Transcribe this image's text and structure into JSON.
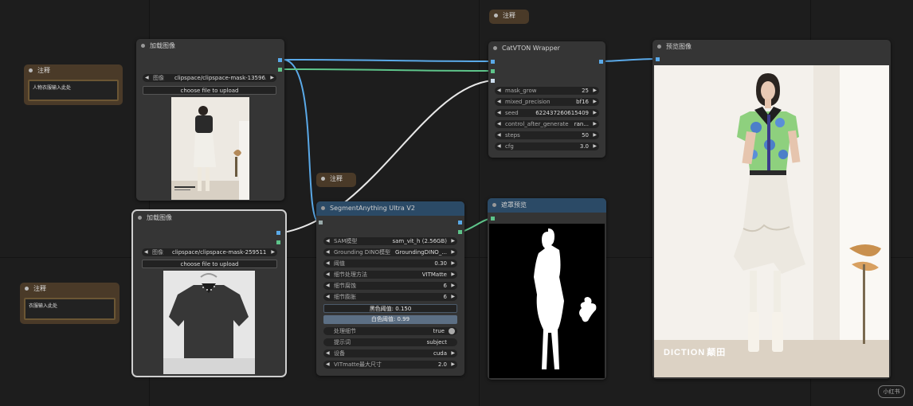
{
  "notes": {
    "top": {
      "title": "注释"
    },
    "left1": {
      "title": "注释",
      "text": "人物衣服输入此处"
    },
    "middle": {
      "title": "注释"
    },
    "left2": {
      "title": "注释",
      "text": "衣服输入此处"
    }
  },
  "load_image_1": {
    "title": "加载图像",
    "image_label": "图像",
    "image_value": "clipspace/clipspace-mask-13596...",
    "upload_label": "choose file to upload"
  },
  "load_image_2": {
    "title": "加载图像",
    "image_label": "图像",
    "image_value": "clipspace/clipspace-mask-259511...",
    "upload_label": "choose file to upload"
  },
  "segment": {
    "title": "SegmentAnything Ultra V2",
    "widgets": [
      {
        "label": "SAM模型",
        "value": "sam_vit_h (2.56GB)"
      },
      {
        "label": "Grounding DINO模型",
        "value": "GroundingDINO_..."
      },
      {
        "label": "阈值",
        "value": "0.30"
      },
      {
        "label": "细节处理方法",
        "value": "VITMatte"
      },
      {
        "label": "细节腐蚀",
        "value": "6"
      },
      {
        "label": "细节膨胀",
        "value": "6"
      }
    ],
    "black_point": "黑色阈值: 0.150",
    "white_point": "白色阈值: 0.99",
    "process_detail_label": "处理细节",
    "process_detail_value": "true",
    "prompt_label": "提示词",
    "prompt_value": "subject",
    "device_label": "设备",
    "device_value": "cuda",
    "max_size_label": "VITmatte最大尺寸",
    "max_size_value": "2.0"
  },
  "catvton": {
    "title": "CatVTON Wrapper",
    "widgets": [
      {
        "label": "mask_grow",
        "value": "25"
      },
      {
        "label": "mixed_precision",
        "value": "bf16"
      },
      {
        "label": "seed",
        "value": "622437260615409"
      },
      {
        "label": "control_after_generate",
        "value": "ran..."
      },
      {
        "label": "steps",
        "value": "50"
      },
      {
        "label": "cfg",
        "value": "3.0"
      }
    ]
  },
  "mask_preview": {
    "title": "遮罩预览"
  },
  "preview_image": {
    "title": "预览图像",
    "brand": "DICTION",
    "brand_cn": "颠田"
  },
  "watermark": "小红书",
  "colors": {
    "note_brown": "#4a3a28",
    "node_grey": "#353535",
    "node_blue_title": "#2b4a66",
    "link_blue": "#5aa9e8",
    "link_green": "#5ec48a"
  }
}
